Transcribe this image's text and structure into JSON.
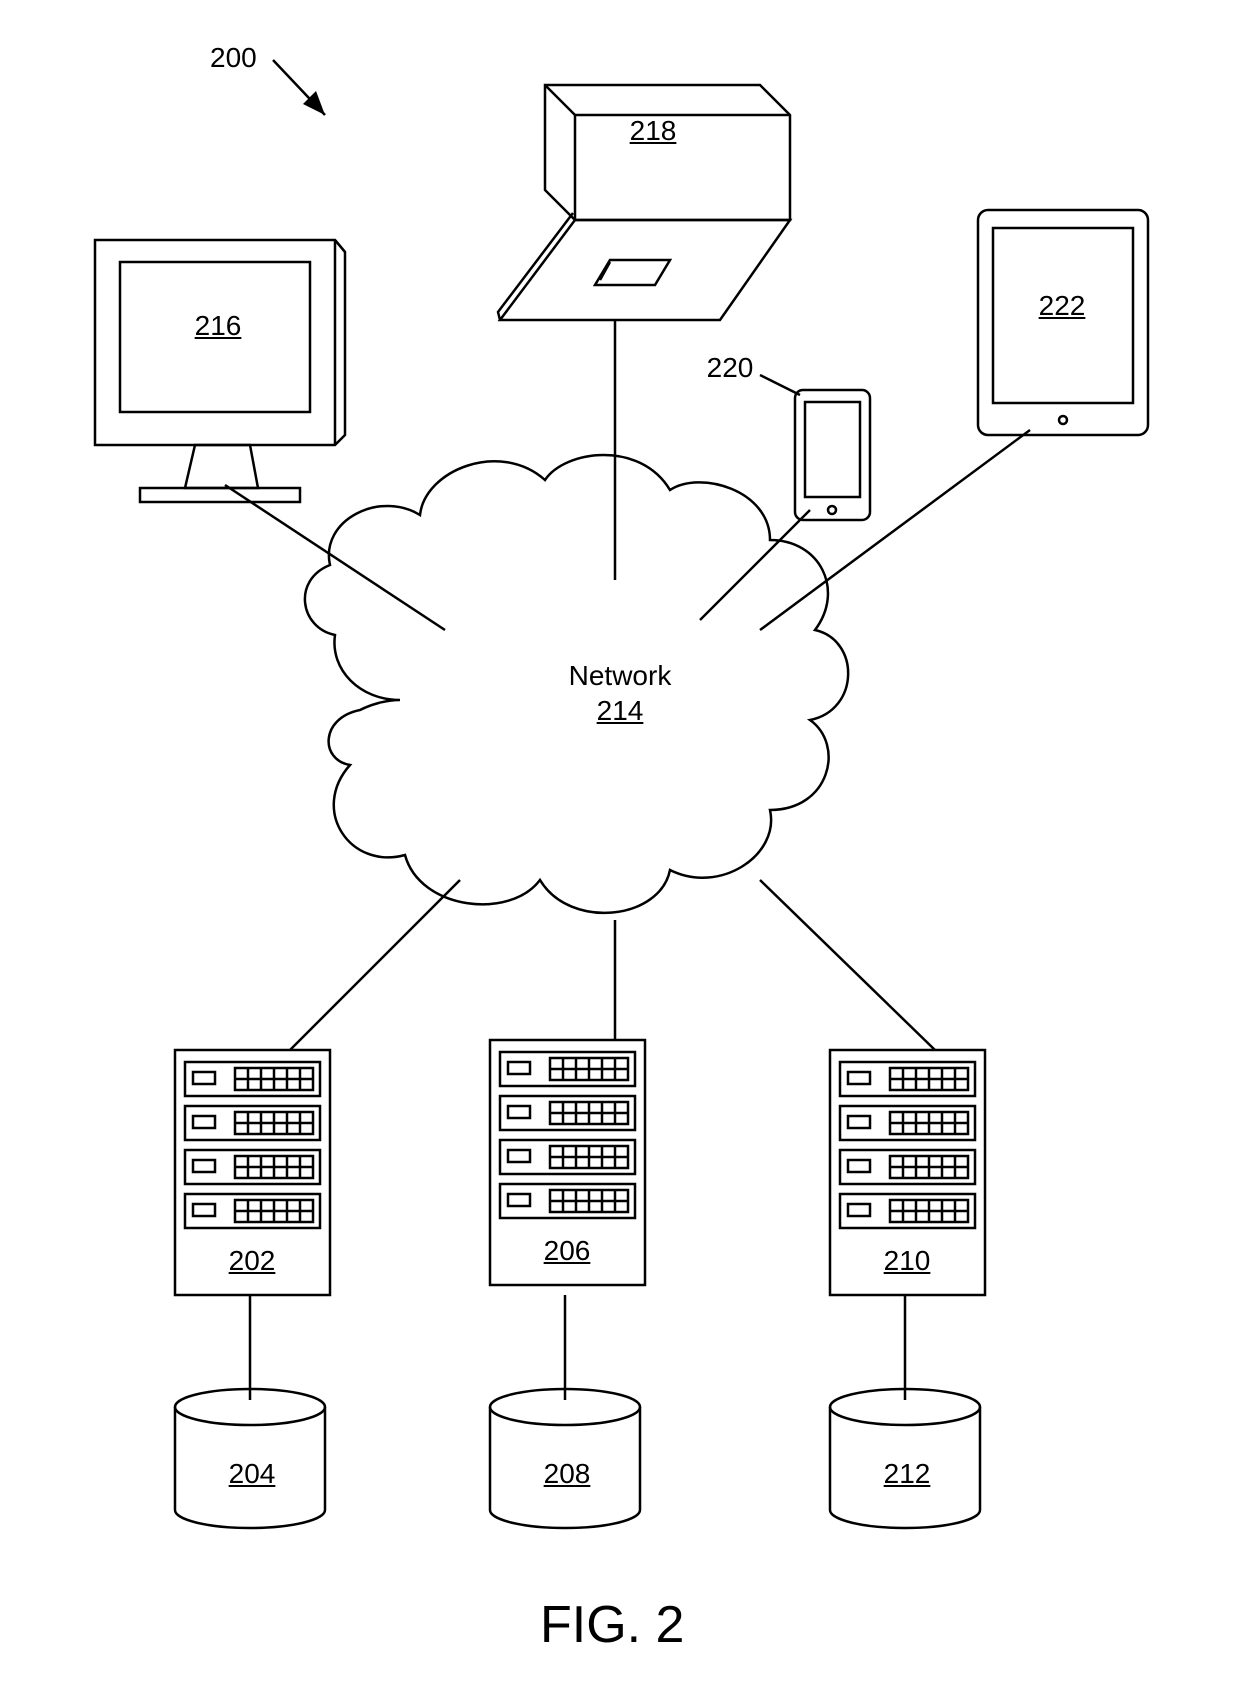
{
  "figure": {
    "caption": "FIG. 2",
    "reference": "200",
    "network": {
      "title": "Network",
      "ref": "214"
    },
    "clients": {
      "desktop": {
        "ref": "216"
      },
      "laptop": {
        "ref": "218"
      },
      "smartphone": {
        "ref": "220"
      },
      "tablet": {
        "ref": "222"
      }
    },
    "servers": [
      {
        "ref": "202"
      },
      {
        "ref": "206"
      },
      {
        "ref": "210"
      }
    ],
    "databases": [
      {
        "ref": "204"
      },
      {
        "ref": "208"
      },
      {
        "ref": "212"
      }
    ]
  }
}
